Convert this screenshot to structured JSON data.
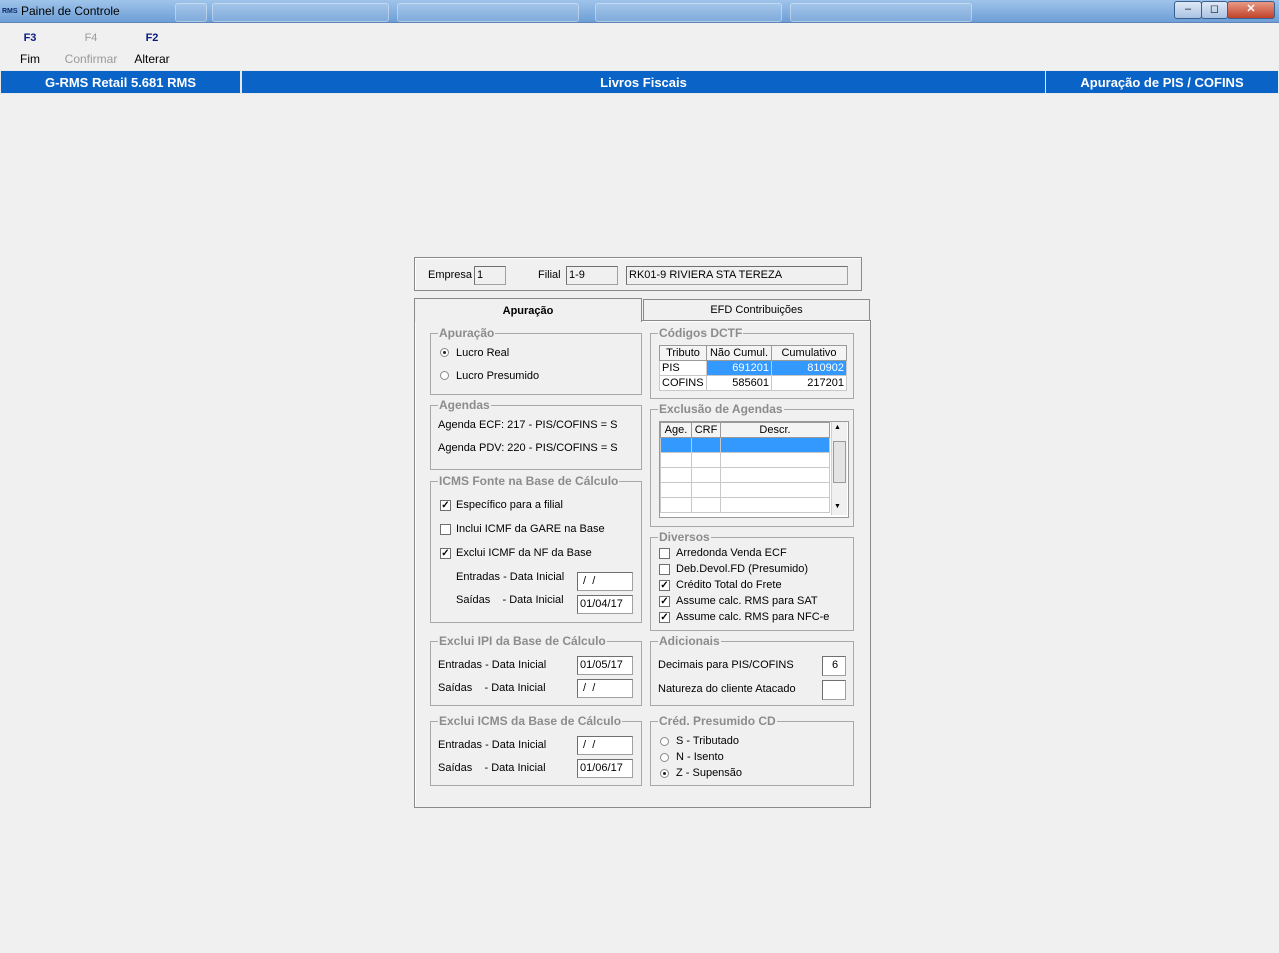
{
  "window": {
    "title": "Painel de Controle",
    "app_icon_text": "RMS",
    "min": "–",
    "max": "◻",
    "close": "✕"
  },
  "toolbar": [
    {
      "key": "F3",
      "label": "Fim",
      "enabled": true
    },
    {
      "key": "F4",
      "label": "Confirmar",
      "enabled": false
    },
    {
      "key": "F2",
      "label": "Alterar",
      "enabled": true
    }
  ],
  "header": {
    "app_name": "G-RMS Retail 5.681 RMS",
    "module": "Livros Fiscais",
    "screen": "Apuração de PIS / COFINS",
    "bar_color": "#0a64c8"
  },
  "company": {
    "empresa_label": "Empresa",
    "empresa_value": "1",
    "filial_label": "Filial",
    "filial_value": "1-9",
    "filial_name": "RK01-9 RIVIERA STA TEREZA"
  },
  "tabs": {
    "active": "Apuração",
    "other": "EFD Contribuições"
  },
  "apuracao": {
    "title": "Apuração",
    "opt_real": "Lucro Real",
    "opt_presumido": "Lucro Presumido",
    "selected": "Lucro Real"
  },
  "agendas": {
    "title": "Agendas",
    "ecf": "Agenda ECF: 217 - PIS/COFINS = S",
    "pdv": "Agenda PDV: 220 - PIS/COFINS = S"
  },
  "icms_fonte": {
    "title": "ICMS Fonte na Base de Cálculo",
    "especifico": "Específico para a filial",
    "especifico_checked": true,
    "inclui": "Inclui ICMF da GARE na Base",
    "inclui_checked": false,
    "exclui": "Exclui ICMF da NF da Base",
    "exclui_checked": true,
    "entradas_label": "Entradas - Data Inicial",
    "entradas_value": " /  /",
    "saidas_label": "Saídas    - Data Inicial",
    "saidas_value": "01/04/17"
  },
  "exclui_ipi": {
    "title": "Exclui IPI da Base de Cálculo",
    "entradas_label": "Entradas - Data Inicial",
    "entradas_value": "01/05/17",
    "saidas_label": "Saídas    - Data Inicial",
    "saidas_value": " /  /"
  },
  "exclui_icms": {
    "title": "Exclui ICMS da Base de Cálculo",
    "entradas_label": "Entradas - Data Inicial",
    "entradas_value": " /  /",
    "saidas_label": "Saídas    - Data Inicial",
    "saidas_value": "01/06/17"
  },
  "dctf": {
    "title": "Códigos DCTF",
    "columns": [
      "Tributo",
      "Não Cumul.",
      "Cumulativo"
    ],
    "rows": [
      {
        "tributo": "PIS",
        "nao_cumul": "691201",
        "cumulativo": "810902",
        "selected": true
      },
      {
        "tributo": "COFINS",
        "nao_cumul": "585601",
        "cumulativo": "217201",
        "selected": false
      }
    ]
  },
  "exclusao": {
    "title": "Exclusão de Agendas",
    "columns": [
      "Age.",
      "CRF",
      "Descr."
    ],
    "scroll_up": "▲",
    "scroll_down": "▼"
  },
  "diversos": {
    "title": "Diversos",
    "items": [
      {
        "label": "Arredonda Venda ECF",
        "checked": false
      },
      {
        "label": "Deb.Devol.FD (Presumido)",
        "checked": false
      },
      {
        "label": "Crédito Total do Frete",
        "checked": true
      },
      {
        "label": "Assume calc. RMS para SAT",
        "checked": true
      },
      {
        "label": "Assume calc. RMS para NFC-e",
        "checked": true
      }
    ]
  },
  "adicionais": {
    "title": "Adicionais",
    "decimais_label": "Decimais para PIS/COFINS",
    "decimais_value": "6",
    "natureza_label": "Natureza do cliente Atacado",
    "natureza_value": ""
  },
  "cred_presumido": {
    "title": "Créd. Presumido CD",
    "options": [
      "S - Tributado",
      "N - Isento",
      "Z - Supensão"
    ],
    "selected": "Z - Supensão"
  },
  "selection_color": "#3399ff"
}
